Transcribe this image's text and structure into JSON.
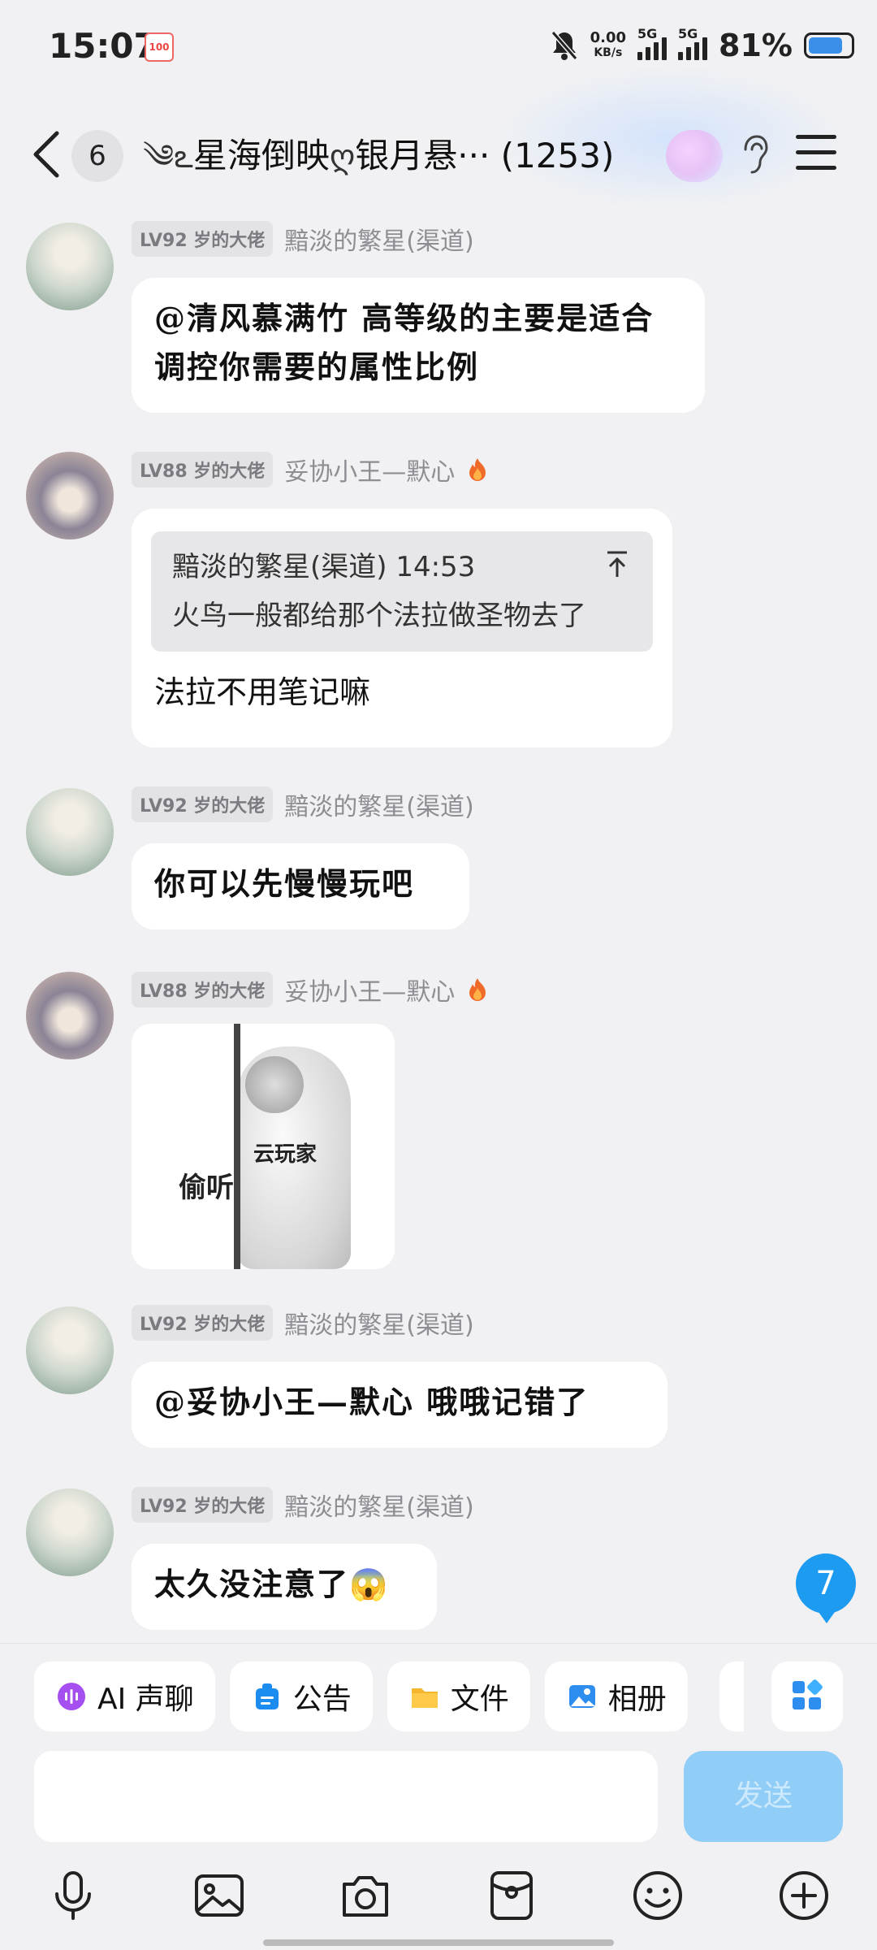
{
  "status_bar": {
    "time": "15:07",
    "calendar_badge": "100",
    "net_speed": "0.00",
    "net_unit": "KB/s",
    "sim1": "5G",
    "sim2": "5G",
    "battery": "81%",
    "battery_level": 0.81
  },
  "header": {
    "unread_count": "6",
    "title": "星海倒映",
    "title_b": "银月悬··· (1253)"
  },
  "messages": [
    {
      "level": "LV92 岁的大佬",
      "nick": "黯淡的繁星(渠道)",
      "text": "@清风慕满竹 高等级的主要是适合调控你需要的属性比例"
    },
    {
      "level": "LV88 岁的大佬",
      "nick": "妥协小王—默心",
      "quote_header": "黯淡的繁星(渠道) 14:53",
      "quote_text": "火鸟一般都给那个法拉做圣物去了",
      "text": "法拉不用笔记嘛"
    },
    {
      "level": "LV92 岁的大佬",
      "nick": "黯淡的繁星(渠道)",
      "text": "你可以先慢慢玩吧"
    },
    {
      "level": "LV88 岁的大佬",
      "nick": "妥协小王—默心",
      "sticker_text_1": "偷听",
      "sticker_text_2": "云玩家"
    },
    {
      "level": "LV92 岁的大佬",
      "nick": "黯淡的繁星(渠道)",
      "text": "@妥协小王—默心 哦哦记错了"
    },
    {
      "level": "LV92 岁的大佬",
      "nick": "黯淡的繁星(渠道)",
      "text": "太久没注意了😱"
    }
  ],
  "new_message_count": "7",
  "quick_bar": {
    "ai_voice": "AI 声聊",
    "notice": "公告",
    "file": "文件",
    "album": "相册"
  },
  "composer": {
    "send": "发送"
  },
  "icons": [
    "mic-icon",
    "image-icon",
    "camera-icon",
    "red-packet-icon",
    "emoji-icon",
    "plus-icon"
  ],
  "colors": {
    "accent": "#1d9bf0",
    "send_disabled": "#90cdf7"
  }
}
